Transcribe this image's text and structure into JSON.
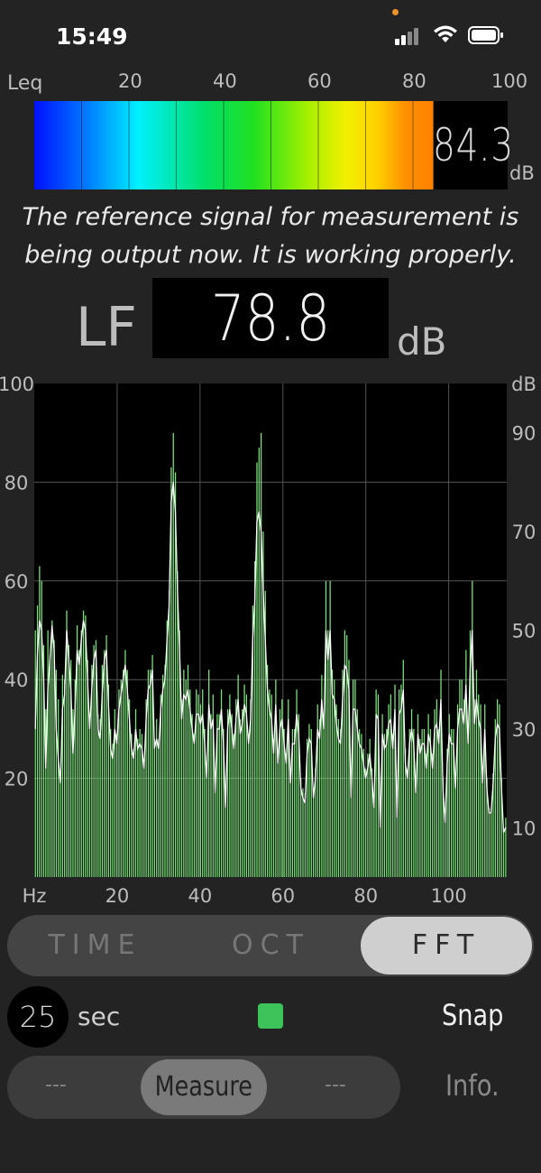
{
  "status_bar": {
    "time": "15:49"
  },
  "leq_meter": {
    "label": "Leq",
    "scale": [
      "20",
      "40",
      "60",
      "80",
      "100"
    ],
    "value": "84.3",
    "unit": "dB",
    "level_fraction": 0.843
  },
  "message": {
    "line1": "The reference signal for measurement is",
    "line2": "being output now.  It is working properly."
  },
  "lf": {
    "label": "LF",
    "value": "78.8",
    "unit": "dB"
  },
  "chart_data": {
    "type": "bar",
    "title": "",
    "xlabel": "Hz",
    "ylabel": "",
    "right_axis_label": "dB",
    "x_ticks": [
      "20",
      "40",
      "60",
      "80",
      "100"
    ],
    "y_ticks_left": [
      "20",
      "40",
      "60",
      "80",
      "100"
    ],
    "y_ticks_right": [
      "10",
      "30",
      "50",
      "70",
      "90"
    ],
    "xlim": [
      0,
      114
    ],
    "ylim": [
      0,
      100
    ],
    "grid": true,
    "bar_color": "#7ee07e",
    "line_color": "#ffffff",
    "values": [
      50,
      55,
      63,
      60,
      47,
      34,
      50,
      45,
      52,
      48,
      42,
      36,
      20,
      41,
      40,
      54,
      47,
      44,
      34,
      40,
      51,
      46,
      50,
      54,
      53,
      44,
      33,
      43,
      47,
      48,
      33,
      32,
      43,
      46,
      49,
      39,
      30,
      27,
      34,
      29,
      38,
      40,
      42,
      46,
      42,
      36,
      29,
      26,
      34,
      28,
      30,
      29,
      24,
      36,
      42,
      42,
      45,
      28,
      32,
      28,
      37,
      41,
      43,
      52,
      58,
      83,
      90,
      82,
      62,
      50,
      36,
      42,
      40,
      43,
      38,
      33,
      29,
      38,
      37,
      35,
      38,
      30,
      20,
      42,
      33,
      37,
      17,
      33,
      33,
      38,
      30,
      14,
      34,
      37,
      33,
      29,
      36,
      41,
      32,
      34,
      39,
      37,
      29,
      36,
      55,
      64,
      84,
      87,
      90,
      70,
      58,
      43,
      38,
      37,
      28,
      40,
      25,
      34,
      36,
      30,
      25,
      36,
      20,
      30,
      30,
      38,
      33,
      20,
      18,
      17,
      28,
      31,
      30,
      18,
      22,
      35,
      32,
      41,
      33,
      60,
      50,
      60,
      42,
      40,
      35,
      32,
      30,
      42,
      50,
      49,
      44,
      16,
      40,
      40,
      34,
      30,
      29,
      26,
      22,
      25,
      28,
      22,
      15,
      38,
      37,
      10,
      33,
      29,
      30,
      35,
      37,
      29,
      39,
      12,
      38,
      39,
      44,
      26,
      22,
      30,
      34,
      30,
      18,
      33,
      28,
      30,
      30,
      25,
      33,
      30,
      25,
      34,
      36,
      30,
      42,
      20,
      12,
      26,
      33,
      30,
      30,
      20,
      35,
      40,
      40,
      36,
      46,
      30,
      50,
      60,
      36,
      42,
      37,
      35,
      21,
      35,
      20,
      14,
      14,
      21,
      32,
      36,
      35,
      20,
      10,
      12
    ],
    "line": [
      30,
      45,
      52,
      50,
      40,
      22,
      38,
      44,
      51,
      46,
      30,
      24,
      19,
      34,
      37,
      50,
      44,
      38,
      25,
      34,
      46,
      43,
      48,
      52,
      50,
      40,
      30,
      38,
      44,
      46,
      30,
      28,
      37,
      44,
      46,
      35,
      26,
      24,
      30,
      27,
      34,
      37,
      40,
      43,
      38,
      32,
      26,
      24,
      30,
      26,
      27,
      26,
      22,
      32,
      38,
      39,
      42,
      26,
      28,
      26,
      34,
      38,
      40,
      48,
      55,
      76,
      80,
      74,
      58,
      46,
      32,
      37,
      36,
      38,
      34,
      30,
      27,
      33,
      33,
      31,
      33,
      27,
      20,
      35,
      30,
      32,
      17,
      30,
      30,
      34,
      27,
      14,
      30,
      34,
      30,
      26,
      32,
      36,
      29,
      31,
      35,
      33,
      27,
      32,
      48,
      56,
      72,
      74,
      70,
      58,
      48,
      38,
      34,
      32,
      25,
      35,
      23,
      30,
      32,
      27,
      23,
      32,
      19,
      27,
      27,
      33,
      29,
      18,
      16,
      15,
      25,
      28,
      27,
      16,
      20,
      30,
      28,
      36,
      30,
      50,
      44,
      50,
      37,
      36,
      31,
      28,
      27,
      36,
      43,
      42,
      38,
      16,
      34,
      34,
      30,
      27,
      26,
      23,
      20,
      22,
      25,
      20,
      14,
      33,
      32,
      10,
      29,
      26,
      27,
      31,
      32,
      26,
      34,
      12,
      33,
      34,
      38,
      23,
      20,
      27,
      30,
      27,
      17,
      29,
      25,
      27,
      27,
      22,
      29,
      27,
      22,
      30,
      31,
      27,
      36,
      18,
      11,
      23,
      29,
      27,
      27,
      18,
      30,
      34,
      34,
      31,
      39,
      27,
      42,
      50,
      31,
      36,
      32,
      30,
      19,
      30,
      18,
      13,
      13,
      19,
      28,
      31,
      30,
      18,
      9,
      10
    ]
  },
  "mode_tabs": {
    "time": "TIME",
    "oct": "OCT",
    "fft": "FFT",
    "selected": "FFT"
  },
  "controls": {
    "seconds_value": "25",
    "seconds_label": "sec",
    "indicator_color": "#3cc35a",
    "snap_label": "Snap",
    "action_left": "---",
    "measure_label": "Measure",
    "action_right": "---",
    "info_label": "Info."
  }
}
